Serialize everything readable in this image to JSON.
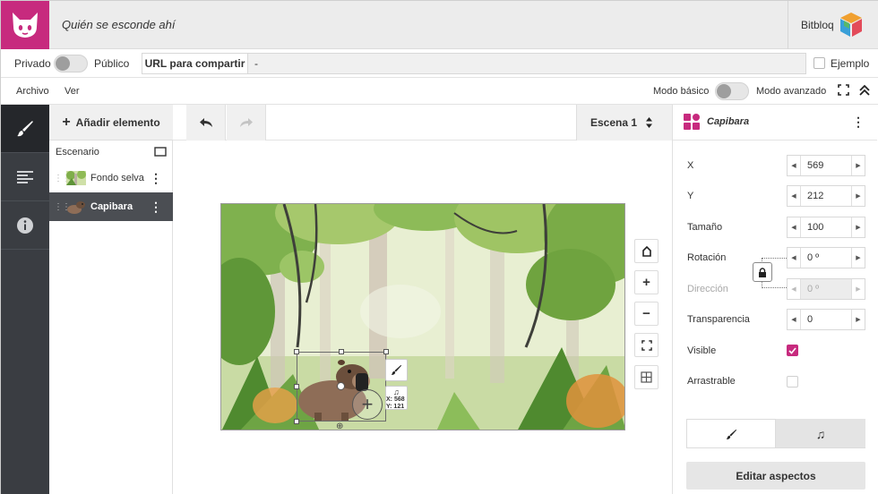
{
  "header": {
    "project_title": "Quién se esconde ahí",
    "brand": "Bitbloq",
    "logo_color": "#c72a7e"
  },
  "share": {
    "private_label": "Privado",
    "public_label": "Público",
    "url_button": "URL para compartir",
    "url_value": "-",
    "example_label": "Ejemplo"
  },
  "menu": {
    "file": "Archivo",
    "view": "Ver",
    "basic_mode": "Modo básico",
    "advanced_mode": "Modo avanzado"
  },
  "sidebar_icons": [
    "brush-icon",
    "align-icon",
    "info-icon"
  ],
  "elements": {
    "add_label": "Añadir elemento",
    "scenario_label": "Escenario",
    "items": [
      {
        "label": "Fondo selva",
        "selected": false
      },
      {
        "label": "Capibara",
        "selected": true
      }
    ]
  },
  "canvas": {
    "scene_label": "Escena 1",
    "coord_readout_x": "X: 568",
    "coord_readout_y": "Y: 121"
  },
  "properties": {
    "element_name": "Capibara",
    "accent": "#c72a7e",
    "fields": {
      "x": {
        "label": "X",
        "value": "569"
      },
      "y": {
        "label": "Y",
        "value": "212"
      },
      "size": {
        "label": "Tamaño",
        "value": "100"
      },
      "rotation": {
        "label": "Rotación",
        "value": "0 º"
      },
      "direction": {
        "label": "Dirección",
        "value": "0 º"
      },
      "transparency": {
        "label": "Transparencia",
        "value": "0"
      }
    },
    "visible_label": "Visible",
    "visible_checked": true,
    "draggable_label": "Arrastrable",
    "draggable_checked": false,
    "edit_button": "Editar aspectos"
  }
}
